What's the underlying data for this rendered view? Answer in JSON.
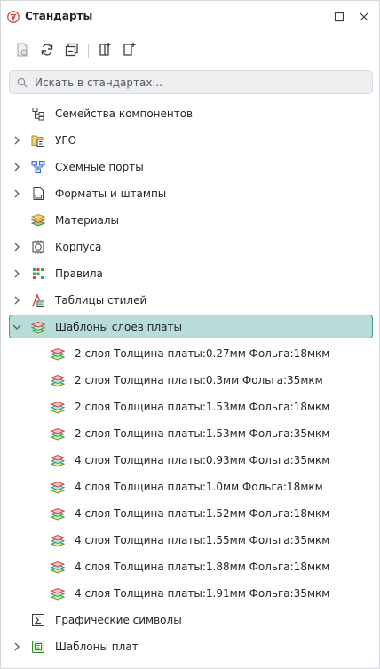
{
  "window": {
    "title": "Стандарты"
  },
  "search": {
    "placeholder": "Искать в стандартах..."
  },
  "tree": {
    "families": "Семейства компонентов",
    "ugo": "УГО",
    "schematic_ports": "Схемные порты",
    "formats": "Форматы и штампы",
    "materials": "Материалы",
    "packages": "Корпуса",
    "rules": "Правила",
    "style_tables": "Таблицы стилей",
    "layer_templates": "Шаблоны слоев платы",
    "layer_children": [
      "2 слоя Толщина платы:0.27мм Фольга:18мкм",
      "2 слоя Толщина платы:0.3мм Фольга:35мкм",
      "2 слоя Толщина платы:1.53мм Фольга:18мкм",
      "2 слоя Толщина платы:1.53мм Фольга:35мкм",
      "4 слоя Толщина платы:0.93мм Фольга:35мкм",
      "4 слоя Толщина платы:1.0мм Фольга:18мкм",
      "4 слоя Толщина платы:1.52мм Фольга:18мкм",
      "4 слоя Толщина платы:1.55мм Фольга:35мкм",
      "4 слоя Толщина платы:1.88мм Фольга:18мкм",
      "4 слоя Толщина платы:1.91мм Фольга:35мкм"
    ],
    "graphic_symbols": "Графические символы",
    "board_templates": "Шаблоны плат"
  },
  "colors": {
    "selection_bg": "#b8dcd8",
    "selection_border": "#4d9c95",
    "accent_red": "#d9413a"
  }
}
